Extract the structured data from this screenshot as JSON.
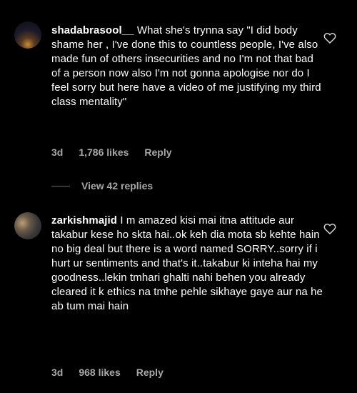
{
  "comments": [
    {
      "username": "shadabrasool__",
      "text": " What she's trynna say \"I did body shame her , I've done this to countless people, I've also made fun of others insecurities and no I'm not that bad of a person now also I'm not gonna apologise nor do I feel sorry but here have a video of me justifying my third class mentality\"",
      "time": "3d",
      "likes": "1,786 likes",
      "reply_label": "Reply",
      "avatar_icon": "profile-photo",
      "like_icon": "heart-outline-icon"
    },
    {
      "username": "zarkishmajid",
      "text": " I m amazed kisi mai itna attitude aur takabur kese ho skta hai..ok keh dia mota sb kehte hain no big deal but there is a word named SORRY..sorry if i hurt ur sentiments and that's it..takabur ki inteha hai my goodness..lekin tmhari ghalti nahi behen you already cleared it k ethics na tmhe pehle sikhaye gaye aur na he ab tum mai hain",
      "time": "3d",
      "likes": "968 likes",
      "reply_label": "Reply",
      "avatar_icon": "profile-photo",
      "like_icon": "heart-outline-icon"
    }
  ],
  "view_replies": {
    "label": "View 42 replies"
  },
  "colors": {
    "background": "#000000",
    "text": "#ffffff",
    "secondary_text": "#a8a8a8"
  }
}
